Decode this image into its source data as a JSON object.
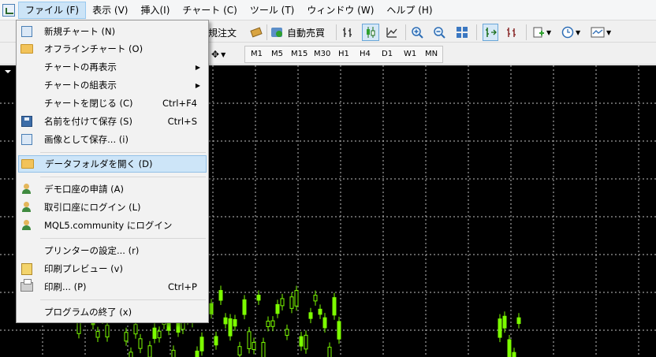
{
  "menubar": {
    "items": [
      "ファイル (F)",
      "表示 (V)",
      "挿入(I)",
      "チャート (C)",
      "ツール (T)",
      "ウィンドウ (W)",
      "ヘルプ (H)"
    ]
  },
  "toolbar": {
    "new_order": "規注文",
    "autotrade": "自動売買",
    "timeframes": [
      "M1",
      "M5",
      "M15",
      "M30",
      "H1",
      "H4",
      "D1",
      "W1",
      "MN"
    ]
  },
  "file_menu": {
    "items": [
      {
        "label": "新規チャート (N)",
        "shortcut": "",
        "icon": "new-chart-icon"
      },
      {
        "label": "オフラインチャート (O)",
        "shortcut": "",
        "icon": "folder-open-icon"
      },
      {
        "label": "チャートの再表示",
        "shortcut": "",
        "icon": "",
        "submenu": true
      },
      {
        "label": "チャートの組表示",
        "shortcut": "",
        "icon": "",
        "submenu": true
      },
      {
        "label": "チャートを閉じる (C)",
        "shortcut": "Ctrl+F4",
        "icon": ""
      },
      {
        "label": "名前を付けて保存 (S)",
        "shortcut": "Ctrl+S",
        "icon": "save-icon"
      },
      {
        "label": "画像として保存... (i)",
        "shortcut": "",
        "icon": "save-picture-icon"
      },
      {
        "label": "データフォルダを開く (D)",
        "shortcut": "",
        "icon": "folder-icon"
      },
      {
        "label": "デモ口座の申請 (A)",
        "shortcut": "",
        "icon": "demo-account-icon"
      },
      {
        "label": "取引口座にログイン (L)",
        "shortcut": "",
        "icon": "login-icon"
      },
      {
        "label": "MQL5.community にログイン",
        "shortcut": "",
        "icon": "mql5-icon"
      },
      {
        "label": "プリンターの設定... (r)",
        "shortcut": "",
        "icon": ""
      },
      {
        "label": "印刷プレビュー (v)",
        "shortcut": "",
        "icon": "print-preview-icon"
      },
      {
        "label": "印刷... (P)",
        "shortcut": "Ctrl+P",
        "icon": "printer-icon"
      },
      {
        "label": "プログラムの終了 (x)",
        "shortcut": "",
        "icon": ""
      }
    ]
  },
  "colors": {
    "chart_bg": "#000000",
    "grid": "#c0c0c0",
    "candle": "#7CFC00",
    "menu_highlight": "#cde5f8"
  }
}
